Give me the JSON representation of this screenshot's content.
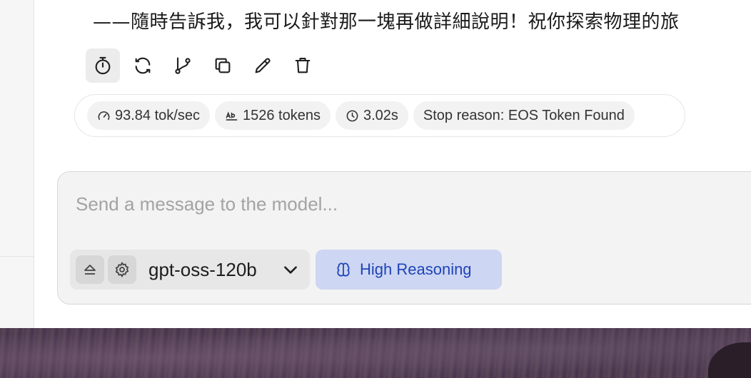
{
  "message": {
    "text": "——隨時告訴我，我可以針對那一塊再做詳細說明！祝你探索物理的旅"
  },
  "actions": [
    {
      "name": "timer",
      "icon": "stopwatch-icon"
    },
    {
      "name": "regenerate",
      "icon": "refresh-icon"
    },
    {
      "name": "branch",
      "icon": "branch-icon"
    },
    {
      "name": "copy",
      "icon": "copy-icon"
    },
    {
      "name": "edit",
      "icon": "pencil-icon"
    },
    {
      "name": "delete",
      "icon": "trash-icon"
    }
  ],
  "stats": {
    "speed": "93.84 tok/sec",
    "tokens": "1526 tokens",
    "time": "3.02s",
    "stop_reason": "Stop reason: EOS Token Found"
  },
  "composer": {
    "placeholder": "Send a message to the model...",
    "model": "gpt-oss-120b",
    "reasoning_label": "High Reasoning"
  },
  "colors": {
    "reasoning_bg": "#cdd6f2",
    "reasoning_text": "#1f43b8"
  }
}
